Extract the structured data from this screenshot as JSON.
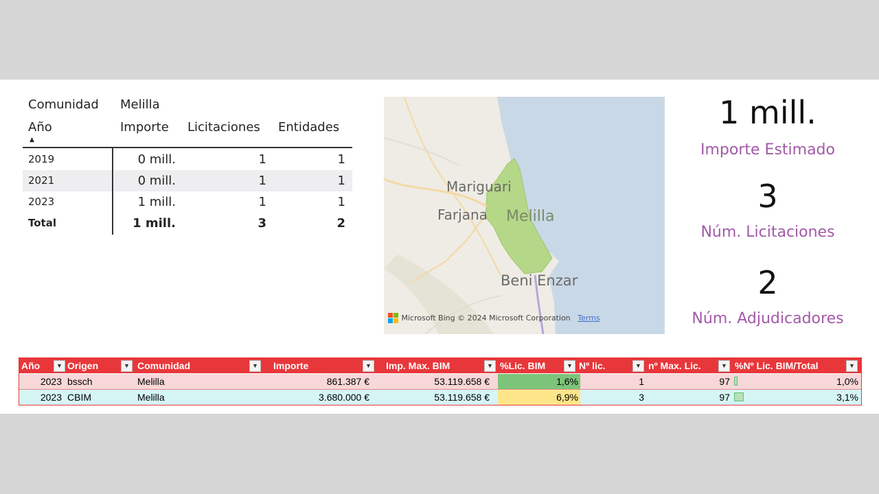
{
  "matrix": {
    "filter_label": "Comunidad",
    "filter_value": "Melilla",
    "col_year": "Año",
    "col_importe": "Importe",
    "col_licitaciones": "Licitaciones",
    "col_entidades": "Entidades",
    "rows": [
      {
        "year": "2019",
        "importe": "0 mill.",
        "licitaciones": "1",
        "entidades": "1"
      },
      {
        "year": "2021",
        "importe": "0 mill.",
        "licitaciones": "1",
        "entidades": "1"
      },
      {
        "year": "2023",
        "importe": "1 mill.",
        "licitaciones": "1",
        "entidades": "1"
      }
    ],
    "total": {
      "label": "Total",
      "importe": "1 mill.",
      "licitaciones": "3",
      "entidades": "2"
    }
  },
  "map": {
    "labels": [
      "Mariguari",
      "Farjana",
      "Melilla",
      "Beni Enzar"
    ],
    "attribution_brand": "Microsoft Bing",
    "attribution_copyright": "© 2024 Microsoft Corporation",
    "terms": "Terms",
    "colors": {
      "land": "#eeece4",
      "sea": "#c9d8e6",
      "region": "#b5d788"
    }
  },
  "kpis": [
    {
      "value": "1 mill.",
      "label": "Importe Estimado"
    },
    {
      "value": "3",
      "label": "Núm. Licitaciones"
    },
    {
      "value": "2",
      "label": "Núm. Adjudicadores"
    }
  ],
  "excel": {
    "headers": [
      "Año",
      "Origen",
      "Comunidad",
      "Importe",
      "Imp. Max. BIM",
      "%Lic. BIM",
      "Nº lic.",
      "nº Max. Lic.",
      "%Nº Lic. BIM/Total"
    ],
    "rows": [
      {
        "year": "2023",
        "origen": "bssch",
        "comunidad": "Melilla",
        "importe": "861.387 €",
        "imp_max": "53.119.658 €",
        "pct_lic": "1,6%",
        "n_lic": "1",
        "n_max": "97",
        "pct_n": "1,0%",
        "pct_n_fraction": 0.01
      },
      {
        "year": "2023",
        "origen": "CBIM",
        "comunidad": "Melilla",
        "importe": "3.680.000 €",
        "imp_max": "53.119.658 €",
        "pct_lic": "6,9%",
        "n_lic": "3",
        "n_max": "97",
        "pct_n": "3,1%",
        "pct_n_fraction": 0.031
      }
    ],
    "colors": {
      "header": "#e8373b",
      "row1": "#f8d7d8",
      "row2": "#d6f5f5",
      "cf_green": "#7dc47b",
      "cf_yellow": "#fde58a"
    }
  }
}
